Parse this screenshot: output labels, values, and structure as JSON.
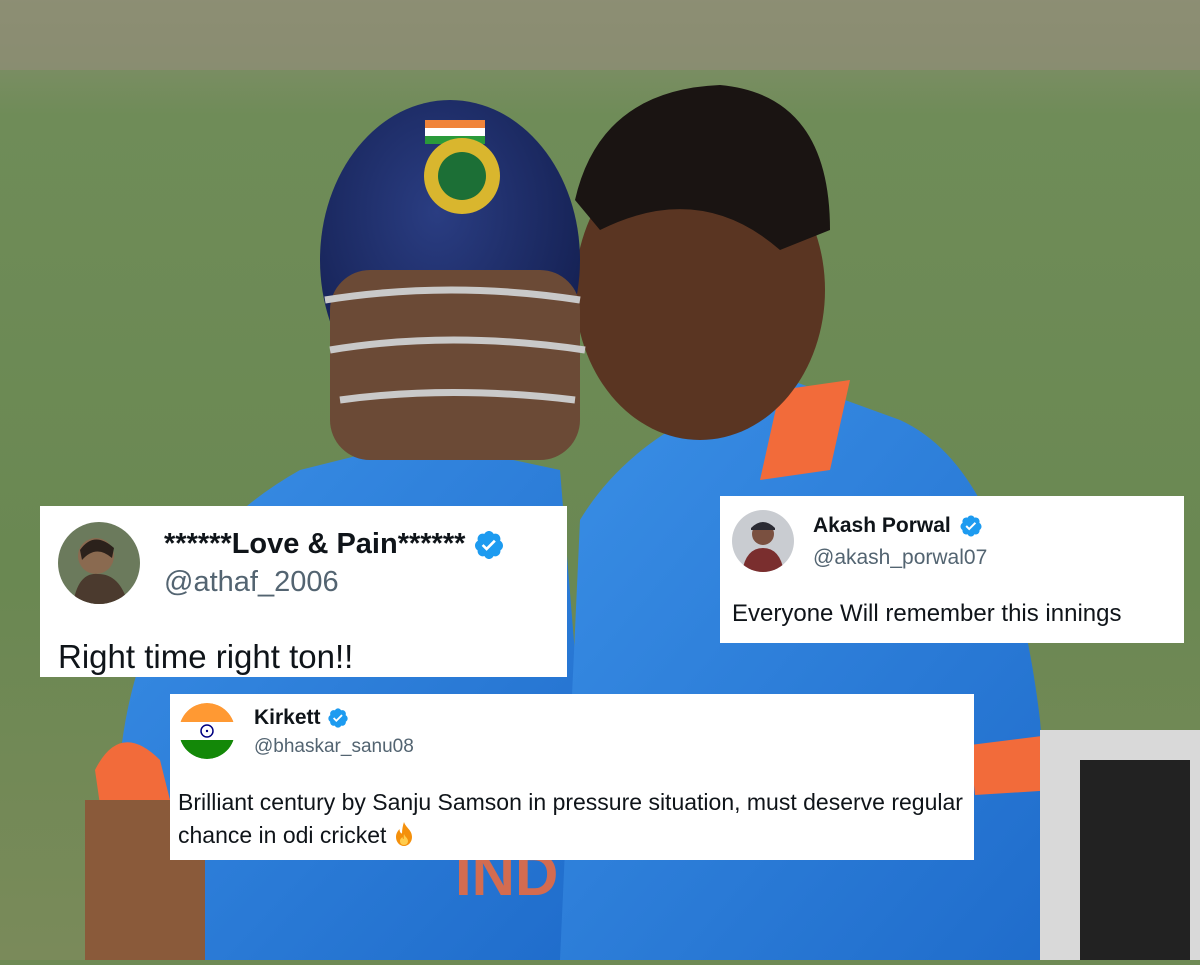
{
  "background": {
    "description_icon": "cricket-celebration-photo",
    "colors": {
      "grass": "#6f8a55",
      "jersey": "#2f7fd6",
      "helmet": "#1c2d6b"
    }
  },
  "tweets": [
    {
      "name": "******Love & Pain******",
      "handle": "@athaf_2006",
      "verified": true,
      "text": "Right time right ton!!"
    },
    {
      "name": "Akash Porwal",
      "handle": "@akash_porwal07",
      "verified": true,
      "text": "Everyone Will remember this innings"
    },
    {
      "name": "Kirkett",
      "handle": "@bhaskar_sanu08",
      "verified": true,
      "text": "Brilliant century by Sanju Samson in pressure situation, must deserve regular chance in odi cricket",
      "emoji_icon": "fire-icon"
    }
  ],
  "accent": {
    "verified_blue": "#1d9bf0",
    "handle_gray": "#536471"
  }
}
